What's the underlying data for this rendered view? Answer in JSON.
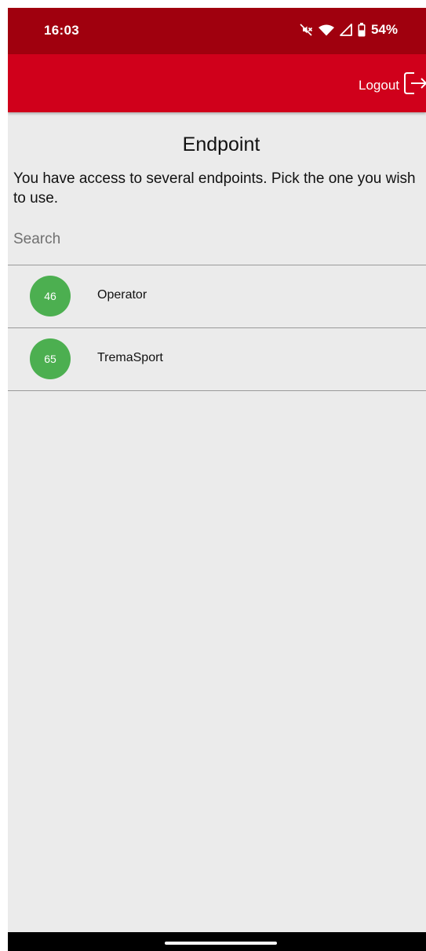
{
  "status_bar": {
    "time": "16:03",
    "battery": "54%",
    "icons": [
      "mute-icon",
      "wifi-icon",
      "signal-icon",
      "battery-icon"
    ]
  },
  "app_bar": {
    "logout_label": "Logout",
    "logout_icon": "logout-icon",
    "color": "#d0001b"
  },
  "page": {
    "title": "Endpoint",
    "intro": "You have access to several endpoints. Pick the one you wish to use."
  },
  "search": {
    "placeholder": "Search",
    "value": ""
  },
  "endpoints": [
    {
      "badge": "46",
      "name": "Operator"
    },
    {
      "badge": "65",
      "name": "TremaSport"
    }
  ],
  "colors": {
    "status_bar": "#a0000e",
    "badge": "#4caf50",
    "background": "#ebebeb"
  }
}
